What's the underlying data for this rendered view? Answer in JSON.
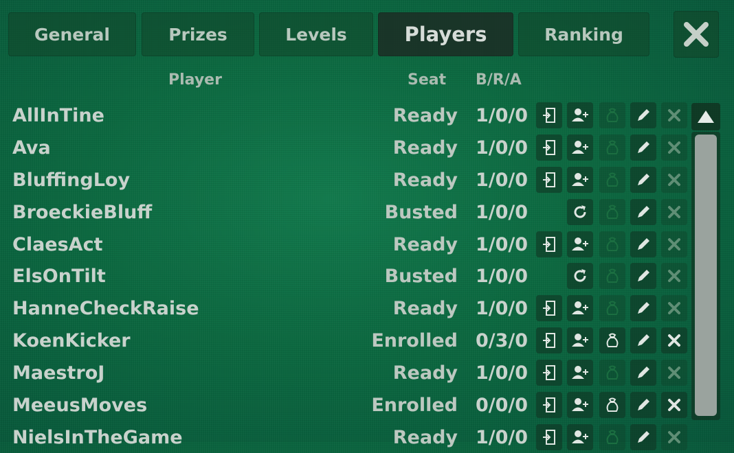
{
  "tabs": [
    "General",
    "Prizes",
    "Levels",
    "Players",
    "Ranking"
  ],
  "active_tab": "Players",
  "close_icon": "close-icon",
  "columns": {
    "player": "Player",
    "seat": "Seat",
    "bra": "B/R/A"
  },
  "players": [
    {
      "name": "AllInTine",
      "status": "Ready",
      "bra": "1/0/0"
    },
    {
      "name": "Ava",
      "status": "Ready",
      "bra": "1/0/0"
    },
    {
      "name": "BluffingLoy",
      "status": "Ready",
      "bra": "1/0/0"
    },
    {
      "name": "BroeckieBluff",
      "status": "Busted",
      "bra": "1/0/0"
    },
    {
      "name": "ClaesAct",
      "status": "Ready",
      "bra": "1/0/0"
    },
    {
      "name": "ElsOnTilt",
      "status": "Busted",
      "bra": "1/0/0"
    },
    {
      "name": "HanneCheckRaise",
      "status": "Ready",
      "bra": "1/0/0"
    },
    {
      "name": "KoenKicker",
      "status": "Enrolled",
      "bra": "0/3/0"
    },
    {
      "name": "MaestroJ",
      "status": "Ready",
      "bra": "1/0/0"
    },
    {
      "name": "MeeusMoves",
      "status": "Enrolled",
      "bra": "0/0/0"
    },
    {
      "name": "NielsInTheGame",
      "status": "Ready",
      "bra": "1/0/0"
    }
  ],
  "action_icons": {
    "seat": "seat-door-icon",
    "rebuy": "add-user-icon",
    "rejoin": "rejoin-icon",
    "addon": "money-bag-icon",
    "edit": "pencil-icon",
    "remove": "remove-x-icon"
  },
  "colors": {
    "felt": "#0c6840",
    "text": "#c8d2cc"
  }
}
